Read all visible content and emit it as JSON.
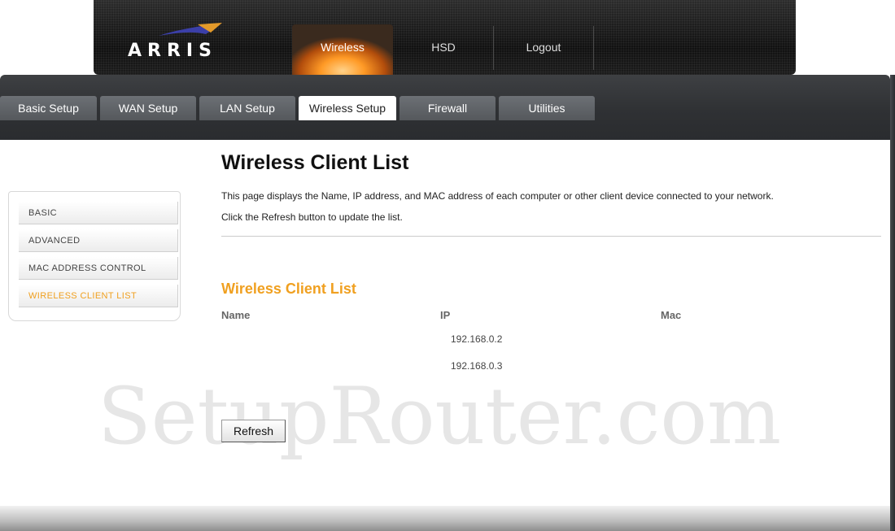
{
  "brand": {
    "logo_text": "ARRIS"
  },
  "top_nav": {
    "items": [
      {
        "label": "Wireless",
        "active": true
      },
      {
        "label": "HSD",
        "active": false
      },
      {
        "label": "Logout",
        "active": false
      }
    ]
  },
  "tabs": {
    "items": [
      {
        "label": "Basic Setup",
        "active": false
      },
      {
        "label": "WAN Setup",
        "active": false
      },
      {
        "label": "LAN Setup",
        "active": false
      },
      {
        "label": "Wireless Setup",
        "active": true
      },
      {
        "label": "Firewall",
        "active": false
      },
      {
        "label": "Utilities",
        "active": false
      }
    ]
  },
  "sidebar": {
    "items": [
      {
        "label": "BASIC",
        "active": false
      },
      {
        "label": "ADVANCED",
        "active": false
      },
      {
        "label": "MAC ADDRESS CONTROL",
        "active": false
      },
      {
        "label": "WIRELESS CLIENT LIST",
        "active": true
      }
    ]
  },
  "main": {
    "title": "Wireless Client List",
    "description_line1": "This page displays the Name, IP address, and MAC address of each computer or other client device connected to your network.",
    "description_line2": "Click the Refresh button to update the list.",
    "section_title": "Wireless Client List",
    "table": {
      "columns": [
        "Name",
        "IP",
        "Mac"
      ],
      "rows": [
        {
          "name": "",
          "ip": "192.168.0.2",
          "mac": ""
        },
        {
          "name": "",
          "ip": "192.168.0.3",
          "mac": ""
        }
      ]
    },
    "refresh_label": "Refresh"
  },
  "watermark": "SetupRouter.com",
  "colors": {
    "accent_orange": "#f0a020",
    "header_dark": "#1c1c1c",
    "tab_bar": "#2f3134",
    "tab_inactive": "#5f6266"
  }
}
